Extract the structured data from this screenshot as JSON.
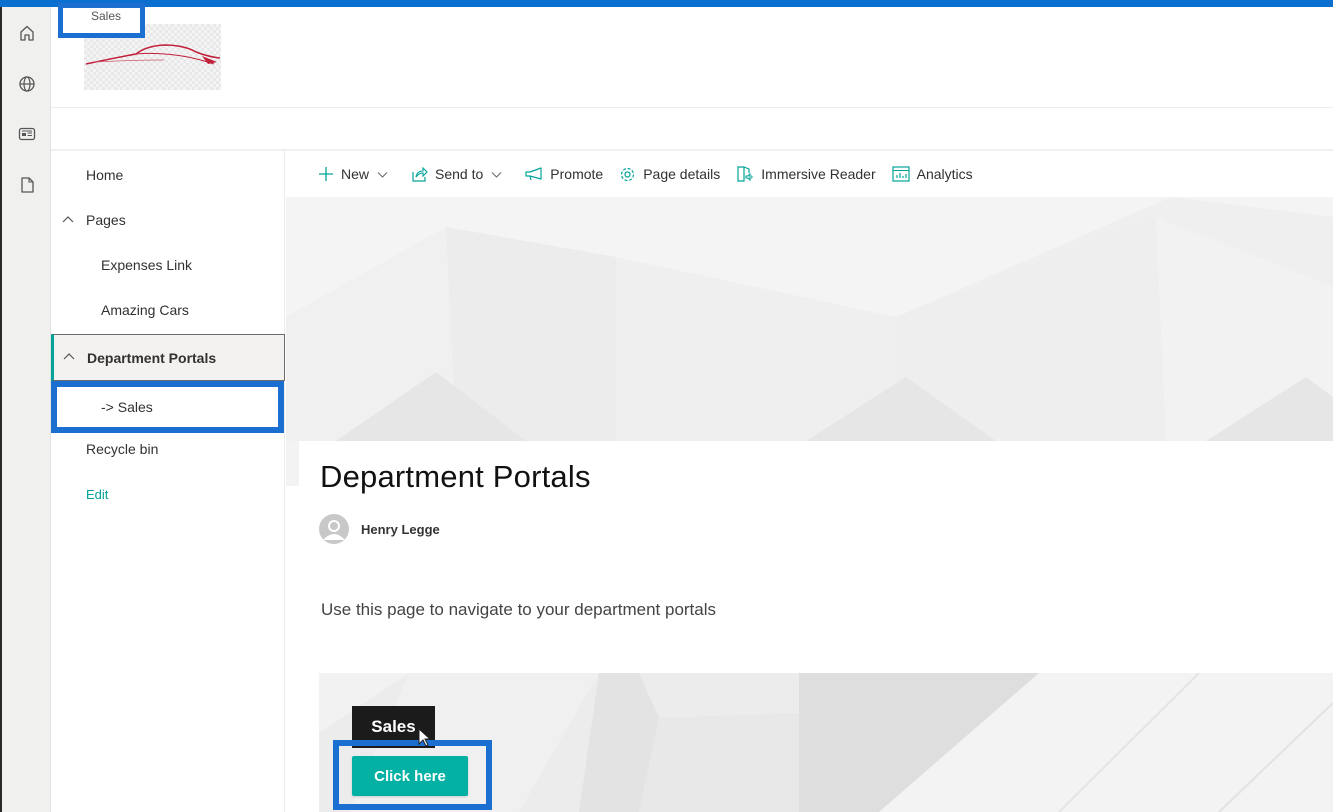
{
  "site": {
    "title": "Sales",
    "accent_color": "#03a39a",
    "highlight_color": "#1b6fd1",
    "topbar_color": "#0a6fcf"
  },
  "appbar": {
    "icons": [
      "home-icon",
      "globe-icon",
      "news-icon",
      "document-icon"
    ]
  },
  "leftnav": {
    "items": [
      {
        "label": "Home",
        "level": 0
      },
      {
        "label": "Pages",
        "level": 0,
        "expanded": true
      },
      {
        "label": "Expenses Link",
        "level": 1
      },
      {
        "label": "Amazing Cars",
        "level": 1
      },
      {
        "label": "Department Portals",
        "level": 0,
        "expanded": true,
        "selected": true
      },
      {
        "label": "-> Sales",
        "level": 1
      },
      {
        "label": "Recycle bin",
        "level": 0
      }
    ],
    "edit_label": "Edit"
  },
  "commandbar": {
    "new_label": "New",
    "send_to_label": "Send to",
    "promote_label": "Promote",
    "page_details_label": "Page details",
    "immersive_reader_label": "Immersive Reader",
    "analytics_label": "Analytics"
  },
  "page": {
    "title": "Department Portals",
    "author": "Henry Legge",
    "description": "Use this page to navigate to your department portals",
    "tile_label": "Sales",
    "cta_label": "Click here",
    "cta_color": "#03b0a4"
  }
}
